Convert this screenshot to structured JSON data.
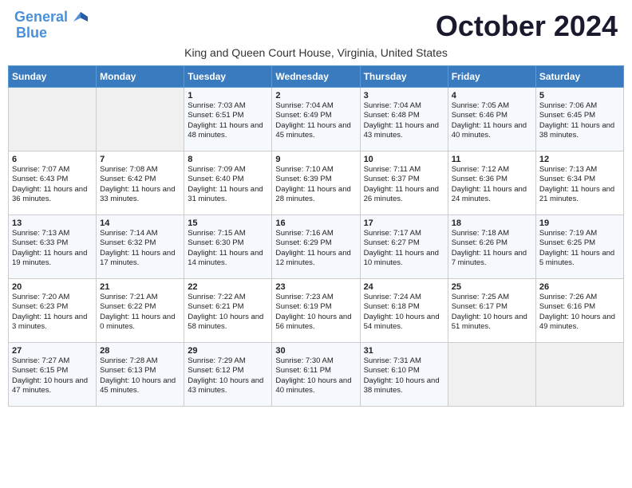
{
  "header": {
    "logo_line1": "General",
    "logo_line2": "Blue",
    "month_title": "October 2024",
    "subtitle": "King and Queen Court House, Virginia, United States"
  },
  "days_of_week": [
    "Sunday",
    "Monday",
    "Tuesday",
    "Wednesday",
    "Thursday",
    "Friday",
    "Saturday"
  ],
  "weeks": [
    [
      {
        "day": "",
        "content": ""
      },
      {
        "day": "",
        "content": ""
      },
      {
        "day": "1",
        "content": "Sunrise: 7:03 AM\nSunset: 6:51 PM\nDaylight: 11 hours and 48 minutes."
      },
      {
        "day": "2",
        "content": "Sunrise: 7:04 AM\nSunset: 6:49 PM\nDaylight: 11 hours and 45 minutes."
      },
      {
        "day": "3",
        "content": "Sunrise: 7:04 AM\nSunset: 6:48 PM\nDaylight: 11 hours and 43 minutes."
      },
      {
        "day": "4",
        "content": "Sunrise: 7:05 AM\nSunset: 6:46 PM\nDaylight: 11 hours and 40 minutes."
      },
      {
        "day": "5",
        "content": "Sunrise: 7:06 AM\nSunset: 6:45 PM\nDaylight: 11 hours and 38 minutes."
      }
    ],
    [
      {
        "day": "6",
        "content": "Sunrise: 7:07 AM\nSunset: 6:43 PM\nDaylight: 11 hours and 36 minutes."
      },
      {
        "day": "7",
        "content": "Sunrise: 7:08 AM\nSunset: 6:42 PM\nDaylight: 11 hours and 33 minutes."
      },
      {
        "day": "8",
        "content": "Sunrise: 7:09 AM\nSunset: 6:40 PM\nDaylight: 11 hours and 31 minutes."
      },
      {
        "day": "9",
        "content": "Sunrise: 7:10 AM\nSunset: 6:39 PM\nDaylight: 11 hours and 28 minutes."
      },
      {
        "day": "10",
        "content": "Sunrise: 7:11 AM\nSunset: 6:37 PM\nDaylight: 11 hours and 26 minutes."
      },
      {
        "day": "11",
        "content": "Sunrise: 7:12 AM\nSunset: 6:36 PM\nDaylight: 11 hours and 24 minutes."
      },
      {
        "day": "12",
        "content": "Sunrise: 7:13 AM\nSunset: 6:34 PM\nDaylight: 11 hours and 21 minutes."
      }
    ],
    [
      {
        "day": "13",
        "content": "Sunrise: 7:13 AM\nSunset: 6:33 PM\nDaylight: 11 hours and 19 minutes."
      },
      {
        "day": "14",
        "content": "Sunrise: 7:14 AM\nSunset: 6:32 PM\nDaylight: 11 hours and 17 minutes."
      },
      {
        "day": "15",
        "content": "Sunrise: 7:15 AM\nSunset: 6:30 PM\nDaylight: 11 hours and 14 minutes."
      },
      {
        "day": "16",
        "content": "Sunrise: 7:16 AM\nSunset: 6:29 PM\nDaylight: 11 hours and 12 minutes."
      },
      {
        "day": "17",
        "content": "Sunrise: 7:17 AM\nSunset: 6:27 PM\nDaylight: 11 hours and 10 minutes."
      },
      {
        "day": "18",
        "content": "Sunrise: 7:18 AM\nSunset: 6:26 PM\nDaylight: 11 hours and 7 minutes."
      },
      {
        "day": "19",
        "content": "Sunrise: 7:19 AM\nSunset: 6:25 PM\nDaylight: 11 hours and 5 minutes."
      }
    ],
    [
      {
        "day": "20",
        "content": "Sunrise: 7:20 AM\nSunset: 6:23 PM\nDaylight: 11 hours and 3 minutes."
      },
      {
        "day": "21",
        "content": "Sunrise: 7:21 AM\nSunset: 6:22 PM\nDaylight: 11 hours and 0 minutes."
      },
      {
        "day": "22",
        "content": "Sunrise: 7:22 AM\nSunset: 6:21 PM\nDaylight: 10 hours and 58 minutes."
      },
      {
        "day": "23",
        "content": "Sunrise: 7:23 AM\nSunset: 6:19 PM\nDaylight: 10 hours and 56 minutes."
      },
      {
        "day": "24",
        "content": "Sunrise: 7:24 AM\nSunset: 6:18 PM\nDaylight: 10 hours and 54 minutes."
      },
      {
        "day": "25",
        "content": "Sunrise: 7:25 AM\nSunset: 6:17 PM\nDaylight: 10 hours and 51 minutes."
      },
      {
        "day": "26",
        "content": "Sunrise: 7:26 AM\nSunset: 6:16 PM\nDaylight: 10 hours and 49 minutes."
      }
    ],
    [
      {
        "day": "27",
        "content": "Sunrise: 7:27 AM\nSunset: 6:15 PM\nDaylight: 10 hours and 47 minutes."
      },
      {
        "day": "28",
        "content": "Sunrise: 7:28 AM\nSunset: 6:13 PM\nDaylight: 10 hours and 45 minutes."
      },
      {
        "day": "29",
        "content": "Sunrise: 7:29 AM\nSunset: 6:12 PM\nDaylight: 10 hours and 43 minutes."
      },
      {
        "day": "30",
        "content": "Sunrise: 7:30 AM\nSunset: 6:11 PM\nDaylight: 10 hours and 40 minutes."
      },
      {
        "day": "31",
        "content": "Sunrise: 7:31 AM\nSunset: 6:10 PM\nDaylight: 10 hours and 38 minutes."
      },
      {
        "day": "",
        "content": ""
      },
      {
        "day": "",
        "content": ""
      }
    ]
  ]
}
